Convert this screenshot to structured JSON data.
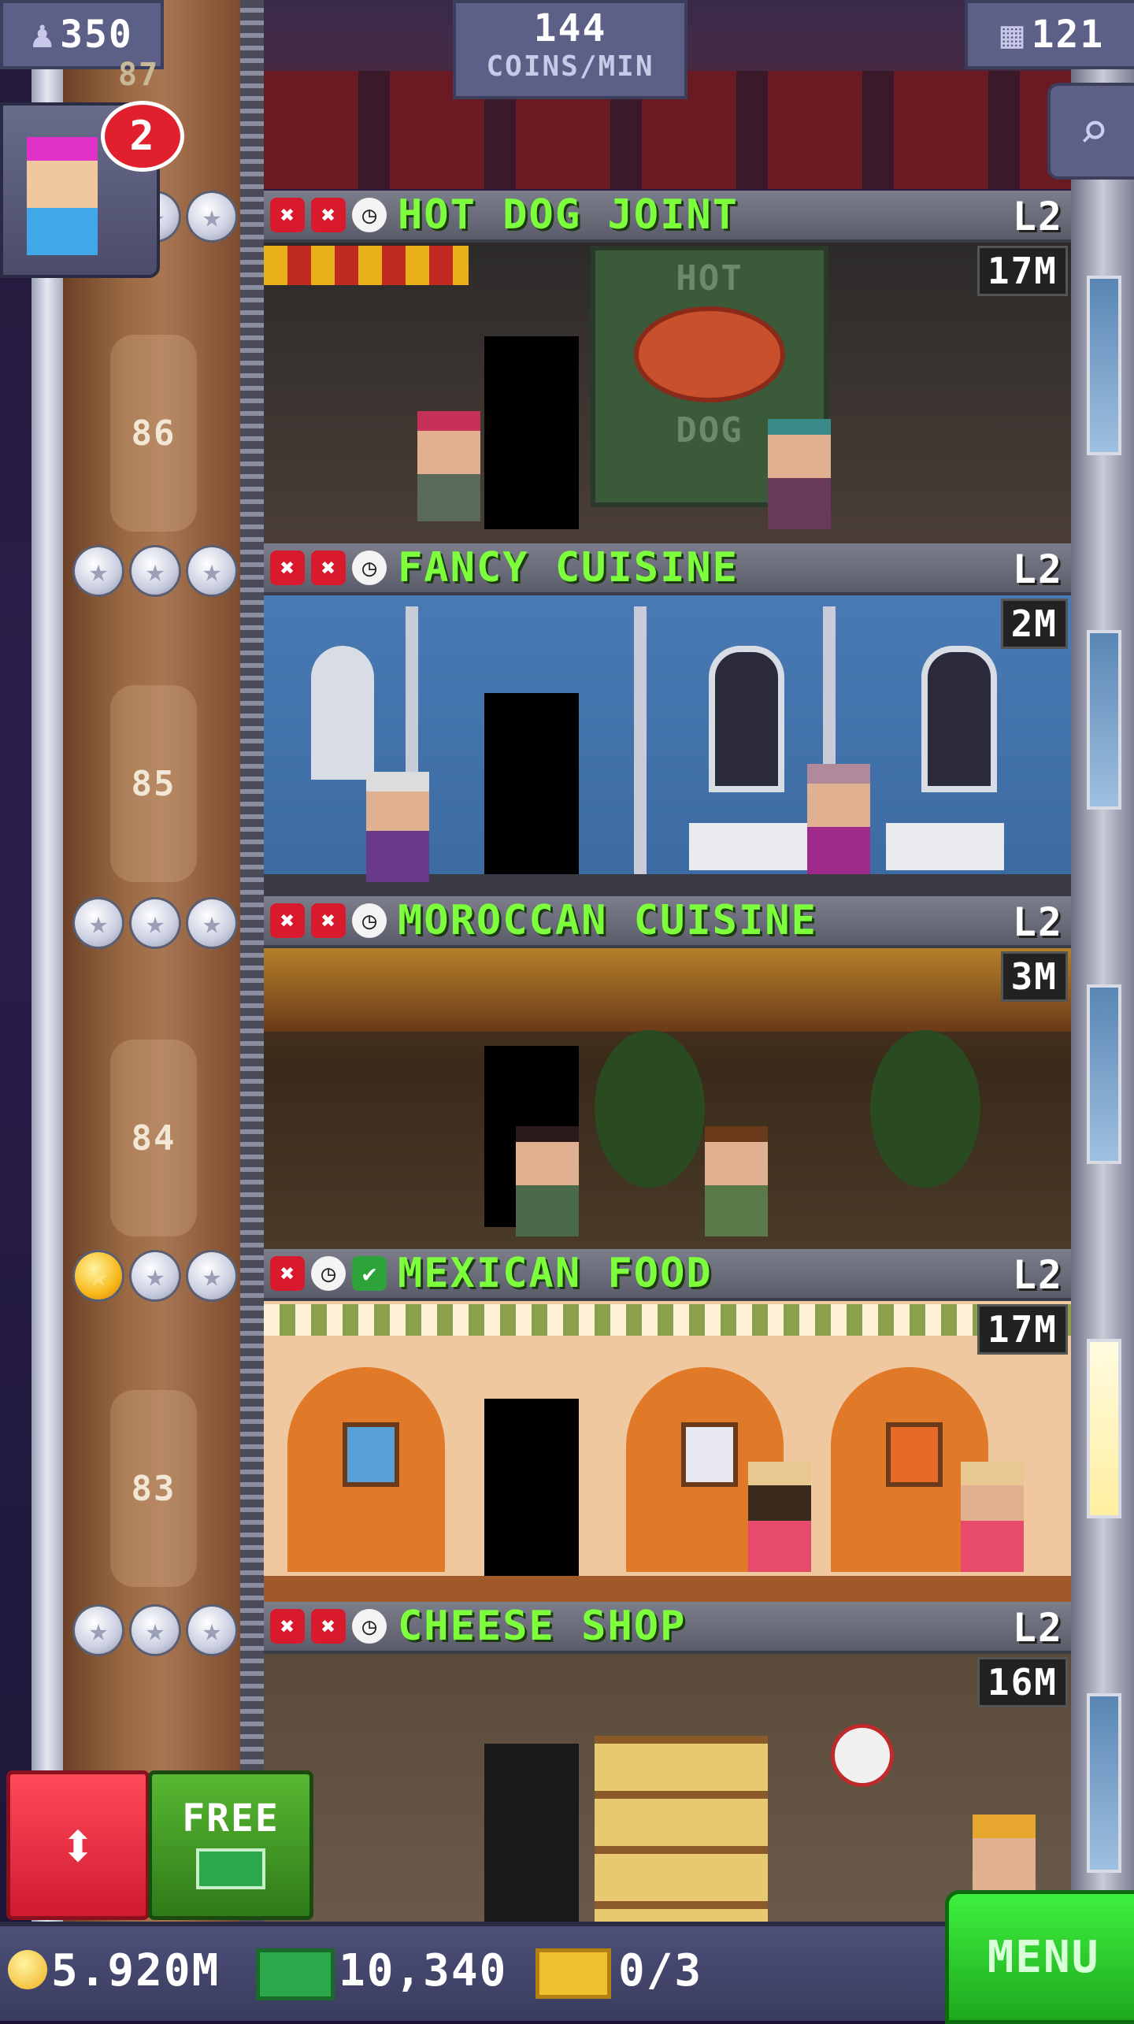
{
  "hud": {
    "population": "350",
    "rate_value": "144",
    "rate_unit": "COINS/MIN",
    "floors_count": "121",
    "notification_count": "2",
    "partial_floor_number": "87"
  },
  "floors": [
    {
      "name": "HOT DOG JOINT",
      "level": "L2",
      "timer": "17M",
      "floor_number": "86",
      "sign_top": "HOT",
      "sign_bottom": "DOG",
      "status": [
        "x",
        "x",
        "clock"
      ],
      "stars": [
        "silver",
        "silver",
        "silver"
      ]
    },
    {
      "name": "FANCY CUISINE",
      "level": "L2",
      "timer": "2M",
      "floor_number": "85",
      "status": [
        "x",
        "x",
        "clock"
      ],
      "stars": [
        "silver",
        "silver",
        "silver"
      ]
    },
    {
      "name": "MOROCCAN CUISINE",
      "level": "L2",
      "timer": "3M",
      "floor_number": "84",
      "status": [
        "x",
        "x",
        "clock"
      ],
      "stars": [
        "silver",
        "silver",
        "silver"
      ]
    },
    {
      "name": "MEXICAN FOOD",
      "level": "L2",
      "timer": "17M",
      "floor_number": "83",
      "status": [
        "x",
        "clock",
        "check"
      ],
      "stars": [
        "gold",
        "silver",
        "silver"
      ]
    },
    {
      "name": "CHEESE SHOP",
      "level": "L2",
      "timer": "16M",
      "status": [
        "x",
        "x",
        "clock"
      ],
      "stars": [
        "silver",
        "silver",
        "silver"
      ]
    }
  ],
  "buttons": {
    "elevator_icon": "up-down-arrows-icon",
    "free_label": "FREE",
    "menu_label": "MENU"
  },
  "bottom": {
    "coins": "5.920M",
    "bux": "10,340",
    "tickets": "0/3"
  },
  "colors": {
    "floor_name": "#7dff3c",
    "elevator_button": "#e8203c",
    "free_button": "#3f9a22",
    "menu_button": "#28c828"
  }
}
